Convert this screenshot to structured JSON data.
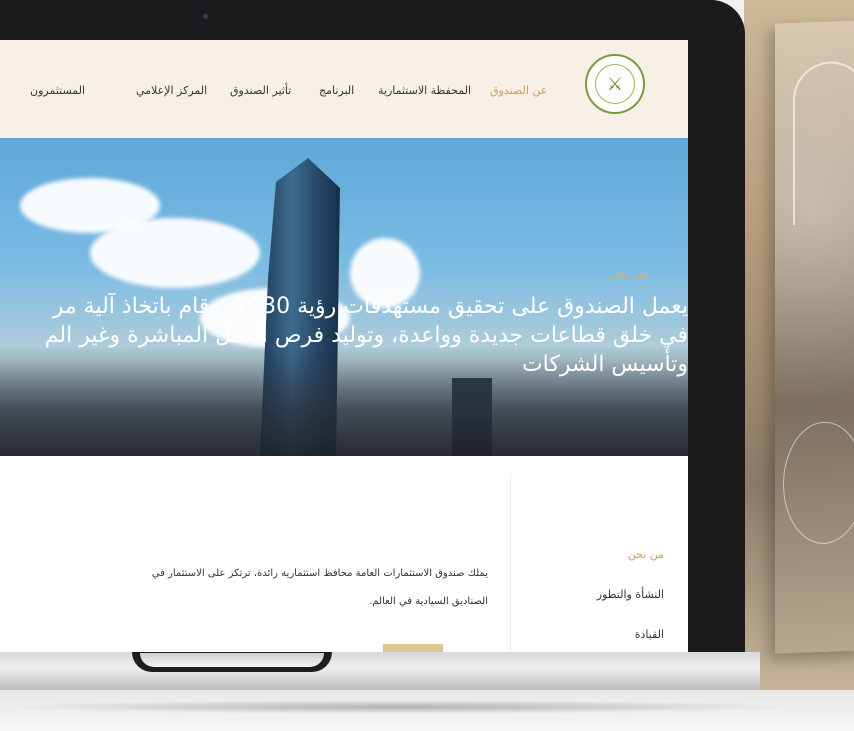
{
  "nav": {
    "items": [
      {
        "label": "عن الصندوق",
        "active": true
      },
      {
        "label": "المحفظة الاستثمارية",
        "active": false
      },
      {
        "label": "البرنامج",
        "active": false
      },
      {
        "label": "تأثير الصندوق",
        "active": false
      },
      {
        "label": "المركز الإعلامي",
        "active": false
      },
      {
        "label": "المستثمرون",
        "active": false
      }
    ],
    "logo_icon": "pif-emblem-icon"
  },
  "hero": {
    "kicker": "من نحن",
    "line1": "يعمل الصندوق على تحقيق مستهدفات رؤية 2030، وقام باتخاذ آلية مر",
    "line2": "في خلق قطاعات جديدة وواعدة، وتوليد فرص العمل المباشرة وغير الم",
    "line3": "وتأسيس الشركات"
  },
  "sidebar": {
    "heading": "من نحن",
    "items": [
      "النشأة والتطور",
      "القيادة"
    ]
  },
  "main": {
    "para_line1": "يملك صندوق الاستثمارات العامة محافظ استثمارية رائدة، ترتكز على الاستثمار في",
    "para_line2": "الصناديق السيادية في العالم."
  },
  "colors": {
    "accent": "#c8a24a",
    "nav_bg": "#f7f0e7",
    "logo_green": "#7a9a3a"
  }
}
